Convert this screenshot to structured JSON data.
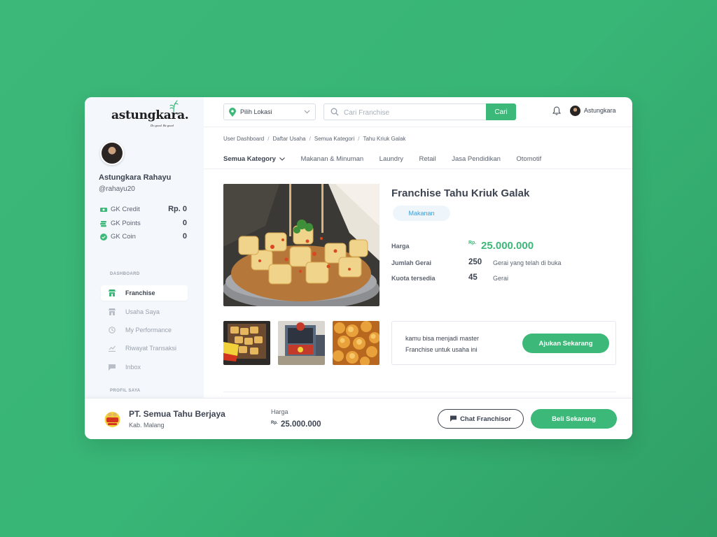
{
  "brand": {
    "name": "astungkara.",
    "tagline": "Do good. Be good"
  },
  "profile": {
    "name": "Astungkara Rahayu",
    "handle": "@rahayu20",
    "stats": [
      {
        "label": "GK Credit",
        "value": "Rp. 0",
        "icon": "money-icon"
      },
      {
        "label": "GK Points",
        "value": "0",
        "icon": "coins-icon"
      },
      {
        "label": "GK Coin",
        "value": "0",
        "icon": "coin-check-icon"
      }
    ]
  },
  "sidebar": {
    "dashboard_label": "DASHBOARD",
    "profile_label": "PROFIL SAYA",
    "items": [
      {
        "label": "Franchise",
        "icon": "store-icon",
        "active": true
      },
      {
        "label": "Usaha Saya",
        "icon": "shop-icon"
      },
      {
        "label": "My Performance",
        "icon": "performance-icon"
      },
      {
        "label": "Riwayat Transaksi",
        "icon": "chart-icon"
      },
      {
        "label": "Inbox",
        "icon": "chat-icon"
      }
    ]
  },
  "topbar": {
    "location_label": "Pilih Lokasi",
    "search_placeholder": "Cari Franchise",
    "search_button": "Cari",
    "user_name": "Astungkara"
  },
  "breadcrumb": [
    "User Dashboard",
    "Daftar Usaha",
    "Semua Kategori",
    "Tahu Kriuk Galak"
  ],
  "categories": [
    {
      "label": "Semua Kategory",
      "active": true
    },
    {
      "label": "Makanan & Minuman"
    },
    {
      "label": "Laundry"
    },
    {
      "label": "Retail"
    },
    {
      "label": "Jasa Pendidikan"
    },
    {
      "label": "Otomotif"
    }
  ],
  "product": {
    "title": "Franchise Tahu Kriuk Galak",
    "category_badge": "Makanan",
    "harga_label": "Harga",
    "price_currency": "Rp.",
    "price": "25.000.000",
    "gerai_label": "Jumlah Gerai",
    "gerai_value": "250",
    "gerai_desc": "Gerai yang telah di buka",
    "kuota_label": "Kuota tersedia",
    "kuota_value": "45",
    "kuota_desc": "Gerai"
  },
  "master": {
    "text": "kamu bisa menjadi master Franchise untuk usaha ini",
    "button": "Ajukan Sekarang"
  },
  "bottom": {
    "company": "PT. Semua Tahu Berjaya",
    "location": "Kab. Malang",
    "harga_label": "Harga",
    "currency": "Rp.",
    "price": "25.000.000",
    "chat_button": "Chat Franchisor",
    "buy_button": "Beli Sekarang"
  },
  "colors": {
    "accent": "#3cb878",
    "background": "#38b676",
    "badge_text": "#3b9bd6"
  }
}
